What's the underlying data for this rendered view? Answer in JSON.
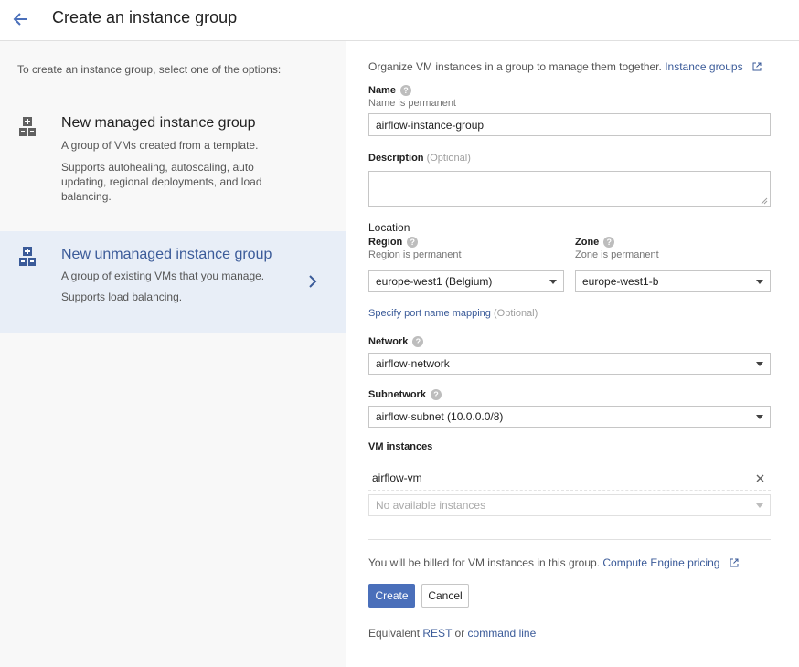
{
  "header": {
    "title": "Create an instance group",
    "back_icon": "arrow-back-icon"
  },
  "left": {
    "intro": "To create an instance group, select one of the options:",
    "options": [
      {
        "title": "New managed instance group",
        "desc": "A group of VMs created from a template.",
        "sub": "Supports autohealing, autoscaling, auto updating, regional deployments, and load balancing.",
        "icon": "instance-group-add-icon",
        "selected": false
      },
      {
        "title": "New unmanaged instance group",
        "desc": "A group of existing VMs that you manage.",
        "sub": "Supports load balancing.",
        "icon": "instance-group-add-icon",
        "selected": true
      }
    ]
  },
  "form": {
    "intro": "Organize VM instances in a group to manage them together.",
    "intro_link": "Instance groups",
    "name": {
      "label": "Name",
      "hint": "Name is permanent",
      "value": "airflow-instance-group"
    },
    "description": {
      "label": "Description",
      "optional": "(Optional)",
      "value": ""
    },
    "location": {
      "label": "Location",
      "region": {
        "label": "Region",
        "hint": "Region is permanent",
        "value": "europe-west1 (Belgium)"
      },
      "zone": {
        "label": "Zone",
        "hint": "Zone is permanent",
        "value": "europe-west1-b"
      }
    },
    "port_mapping": {
      "link": "Specify port name mapping",
      "optional": "(Optional)"
    },
    "network": {
      "label": "Network",
      "value": "airflow-network"
    },
    "subnetwork": {
      "label": "Subnetwork",
      "value": "airflow-subnet (10.0.0.0/8)"
    },
    "vm_instances": {
      "label": "VM instances",
      "items": [
        "airflow-vm"
      ],
      "placeholder": "No available instances"
    },
    "billing": {
      "text": "You will be billed for VM instances in this group.",
      "link": "Compute Engine pricing"
    },
    "buttons": {
      "create": "Create",
      "cancel": "Cancel"
    },
    "equivalent": {
      "prefix": "Equivalent",
      "rest": "REST",
      "or": "or",
      "cmd": "command line"
    }
  },
  "colors": {
    "accent": "#4a6fba",
    "link": "#3b5b99",
    "selected_bg": "#e8eef7",
    "left_bg": "#f8f8f8"
  },
  "help_glyph": "?"
}
